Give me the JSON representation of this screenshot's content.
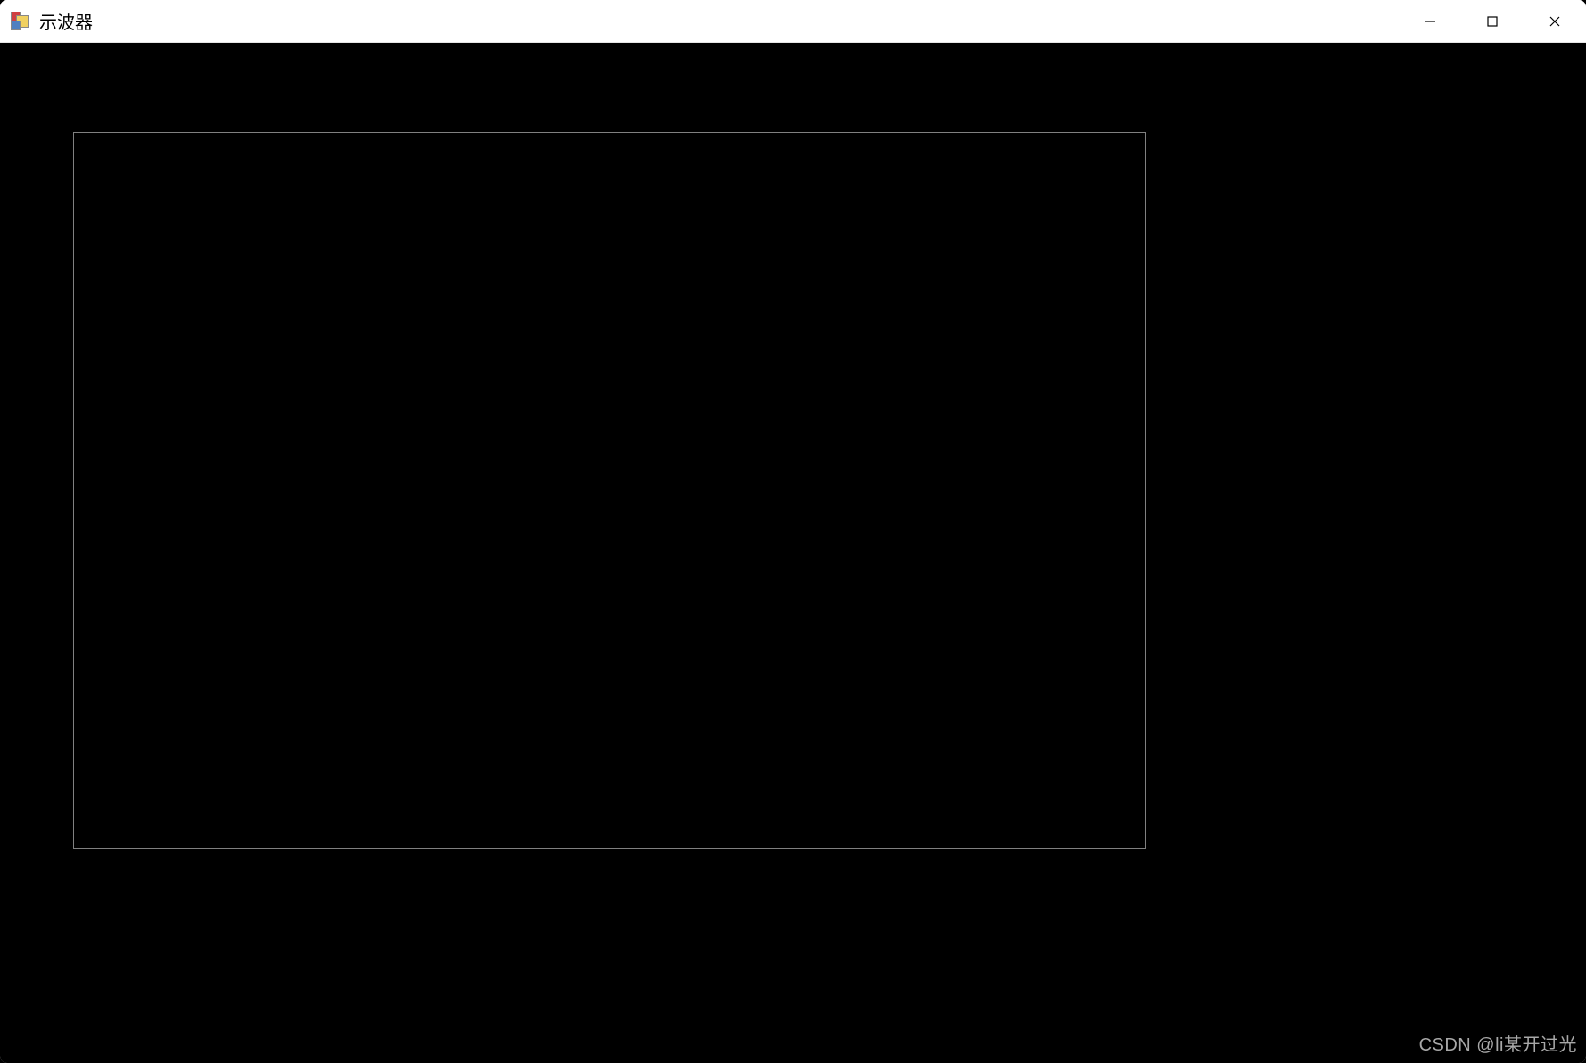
{
  "window": {
    "title": "示波器"
  },
  "watermark": {
    "text": "CSDN @li某开过光"
  }
}
